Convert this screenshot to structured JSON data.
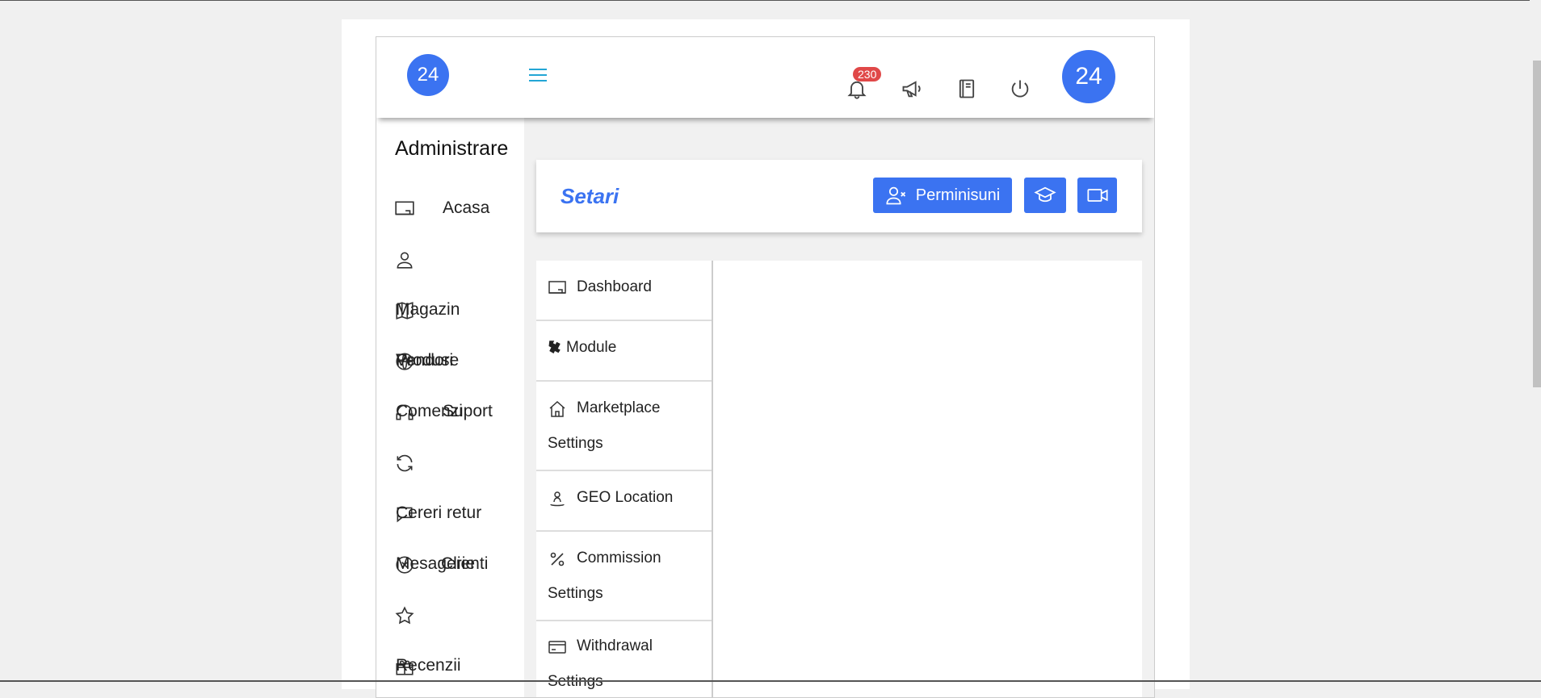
{
  "header": {
    "logo_text": "24",
    "notifications_count": "230",
    "avatar_text": "24",
    "icons": [
      "bell-icon",
      "megaphone-icon",
      "book-icon",
      "power-icon"
    ]
  },
  "sidebar": {
    "title": "Administrare",
    "items": [
      {
        "label": "Acasa",
        "icon": "monitor-icon"
      },
      {
        "label": "",
        "icon": "user-icon"
      },
      {
        "label": "Magazin",
        "icon": "map-icon"
      },
      {
        "label": "Vendori",
        "icon": "globe-icon"
      },
      {
        "label": "Produse",
        "icon": "globe-icon"
      },
      {
        "label": "Comenzi",
        "icon": "headset-icon"
      },
      {
        "label": "Suport",
        "icon": "headset-icon"
      },
      {
        "label": "",
        "icon": "refresh-icon"
      },
      {
        "label": "Cereri retur",
        "icon": "chat-icon"
      },
      {
        "label": "Mesagerie",
        "icon": "circle-x-icon"
      },
      {
        "label": "Clienti",
        "icon": "circle-x-icon"
      },
      {
        "label": "",
        "icon": "star-icon"
      },
      {
        "label": "Recenzii",
        "icon": "gift-icon"
      }
    ]
  },
  "settings": {
    "title": "Setari",
    "permissions_label": "Perminisuni"
  },
  "submenu": {
    "items": [
      {
        "line1": "Dashboard",
        "line2": "",
        "icon": "monitor-icon"
      },
      {
        "line1": "Module",
        "line2": "",
        "icon": "puzzle-icon"
      },
      {
        "line1": "Marketplace",
        "line2": "Settings",
        "icon": "home-icon"
      },
      {
        "line1": "GEO Location",
        "line2": "",
        "icon": "person-pin-icon"
      },
      {
        "line1": "Commission",
        "line2": "Settings",
        "icon": "percent-icon"
      },
      {
        "line1": "Withdrawal",
        "line2": "Settings",
        "icon": "credit-card-icon"
      }
    ]
  },
  "colors": {
    "primary": "#3b73f1",
    "badge": "#e04848",
    "hamburger": "#23a6d5",
    "background": "#f0f0f0"
  }
}
